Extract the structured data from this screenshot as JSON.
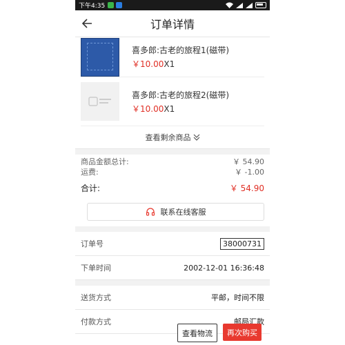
{
  "status_bar": {
    "time": "下午4:35",
    "wifi_icon": "wifi-icon",
    "signal_icon": "signal-icon",
    "battery_icon": "battery-icon"
  },
  "header": {
    "title": "订单详情",
    "back_icon": "back-arrow-icon"
  },
  "products": [
    {
      "name": "喜多郎:古老的旅程1(磁带)",
      "price": "￥10.00",
      "qty": "X1"
    },
    {
      "name": "喜多郎:古老的旅程2(磁带)",
      "price": "￥10.00",
      "qty": "X1"
    }
  ],
  "more_label": "查看剩余商品",
  "summary": {
    "goods_label": "商品金额总计:",
    "goods_value": "￥ 54.90",
    "shipping_label": "运费:",
    "shipping_value": "￥ -1.00",
    "total_label": "合计:",
    "total_value": "￥ 54.90"
  },
  "service_button": "联系在线客服",
  "info": {
    "order_no_label": "订单号",
    "order_no": "38000731",
    "order_time_label": "下单时间",
    "order_time": "2002-12-01 16:36:48",
    "delivery_label": "送货方式",
    "delivery_value": "平邮，时间不限",
    "payment_label": "付款方式",
    "payment_value": "邮局汇款"
  },
  "actions": {
    "logistics": "查看物流",
    "rebuy": "再次购买"
  },
  "colors": {
    "accent_red": "#e02e24",
    "button_red": "#e8392f"
  }
}
